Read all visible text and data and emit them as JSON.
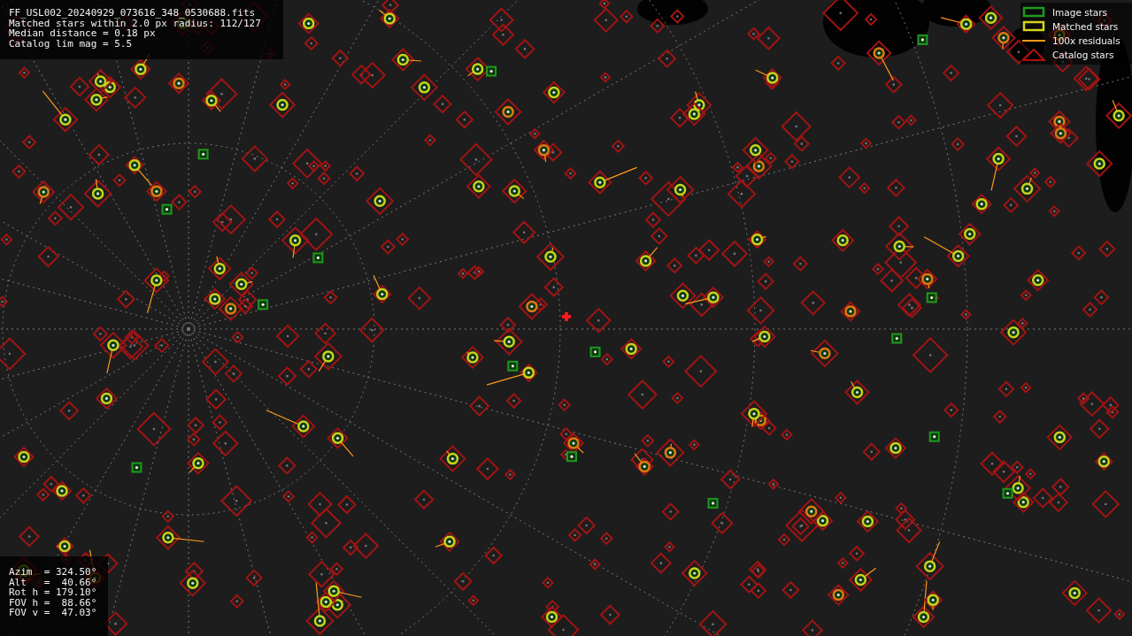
{
  "header": {
    "lines": [
      "FF_USL002_20240929_073616_348_0530688.fits",
      "Matched stars within 2.0 px radius: 112/127",
      "Median distance = 0.18 px",
      "Catalog lim mag = 5.5"
    ]
  },
  "legend": [
    {
      "kind": "box",
      "label": "Image stars",
      "color": "#1e9a1e"
    },
    {
      "kind": "box",
      "label": "Matched stars",
      "color": "#d4d41c"
    },
    {
      "kind": "line",
      "label": "100x residuals",
      "color": "#ff9a1a"
    },
    {
      "kind": "diamond",
      "label": "Catalog stars",
      "color": "#b01010"
    }
  ],
  "pointing": {
    "lines": [
      "Azim  = 324.50°",
      "Alt   =  40.66°",
      "Rot h = 179.10°",
      "FOV h =  88.66°",
      "FOV v =  47.03°"
    ]
  }
}
